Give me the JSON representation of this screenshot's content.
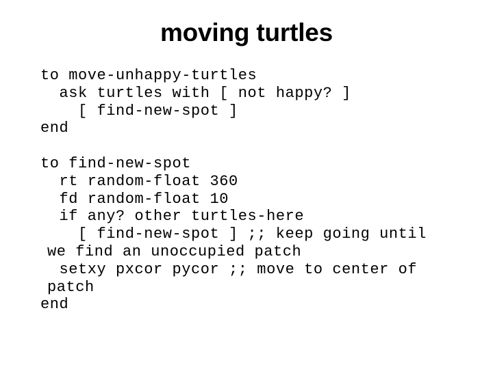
{
  "slide": {
    "title": "moving turtles",
    "background_color": "#ffffff",
    "text_color": "#000000"
  },
  "code": {
    "language": "NetLogo",
    "lines": [
      {
        "text": "to move-unhappy-turtles"
      },
      {
        "text": "  ask turtles with [ not happy? ]"
      },
      {
        "text": "    [ find-new-spot ]"
      },
      {
        "text": "end"
      },
      {
        "text": ""
      },
      {
        "text": "to find-new-spot"
      },
      {
        "text": "  rt random-float 360"
      },
      {
        "text": "  fd random-float 10"
      },
      {
        "text": "  if any? other turtles-here"
      },
      {
        "text": "    [ find-new-spot ] ;; keep going until we find an unoccupied patch"
      },
      {
        "text": "  setxy pxcor pycor ;; move to center of patch"
      },
      {
        "text": "end"
      }
    ]
  }
}
